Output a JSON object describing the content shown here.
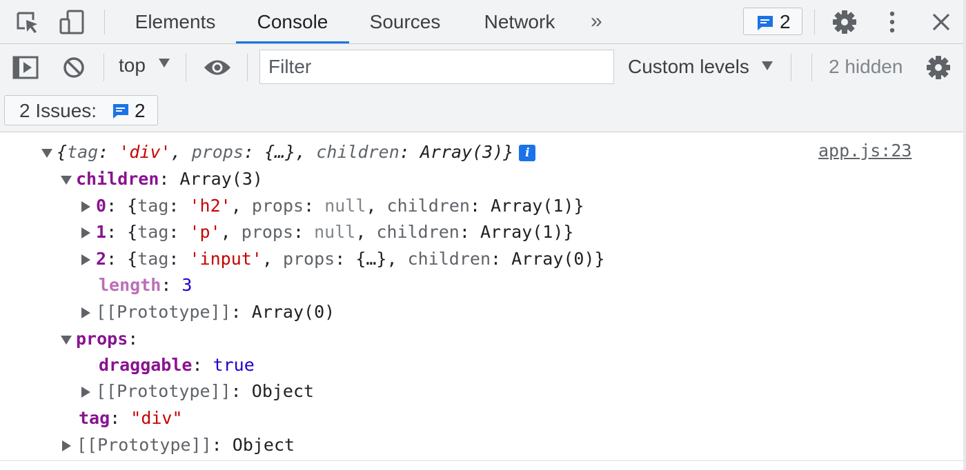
{
  "tabbar": {
    "inspect_icon": "inspect-element-icon",
    "device_icon": "device-toolbar-icon",
    "tabs": [
      {
        "label": "Elements",
        "active": false
      },
      {
        "label": "Console",
        "active": true
      },
      {
        "label": "Sources",
        "active": false
      },
      {
        "label": "Network",
        "active": false
      }
    ],
    "more_tabs": "»",
    "issues_count": "2",
    "settings_icon": "gear-icon",
    "menu_icon": "kebab-menu-icon",
    "close_label": "✕",
    "accent_color": "#1a73e8"
  },
  "toolbar": {
    "context": "top",
    "filter_placeholder": "Filter",
    "levels": "Custom levels",
    "hidden": "2 hidden"
  },
  "issues_bar": {
    "label": "2 Issues:",
    "count": "2"
  },
  "console": {
    "source": "app.js:23",
    "summary": {
      "open": "{",
      "k1": "tag",
      "v1": "'div'",
      "k2": "props",
      "v2": "{…}",
      "k3": "children",
      "v3": "Array(3)",
      "close": "}",
      "info": "i"
    },
    "children_key": "children",
    "children_val": "Array(3)",
    "items": [
      {
        "index": "0",
        "tag": "'h2'",
        "props": "null",
        "children": "Array(1)"
      },
      {
        "index": "1",
        "tag": "'p'",
        "props": "null",
        "children": "Array(1)"
      },
      {
        "index": "2",
        "tag": "'input'",
        "props": "{…}",
        "children": "Array(0)"
      }
    ],
    "length_key": "length",
    "length_val": "3",
    "proto_label": "[[Prototype]]",
    "array_proto": "Array(0)",
    "props_key": "props",
    "draggable_key": "draggable",
    "draggable_val": "true",
    "object_proto": "Object",
    "tag_key": "tag",
    "tag_val": "\"div\"",
    "root_proto": "Object"
  }
}
